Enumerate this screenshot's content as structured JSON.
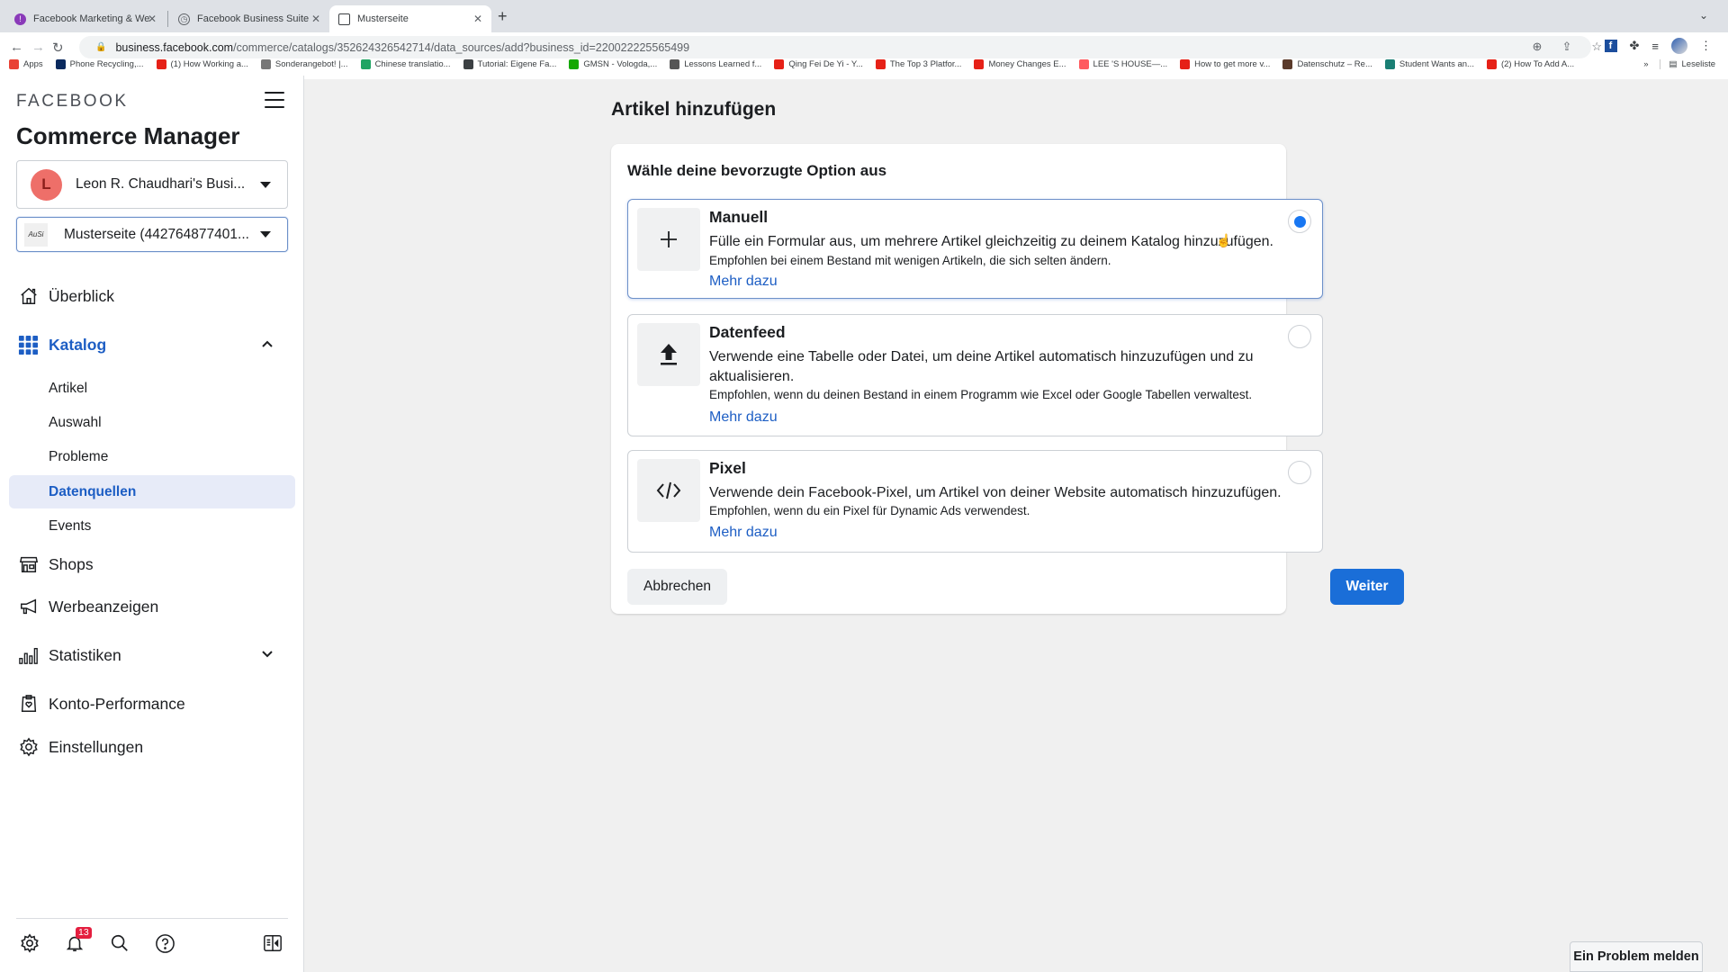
{
  "browser": {
    "tabs": [
      {
        "title": "Facebook Marketing & Werbea",
        "icon": "purple-circle-icon",
        "color": "#8a3ab9"
      },
      {
        "title": "Facebook Business Suite",
        "icon": "business-suite-icon",
        "color": "#5f6368"
      },
      {
        "title": "Musterseite",
        "icon": "page-icon",
        "color": "#3c4043",
        "active": true
      }
    ],
    "url_host": "business.facebook.com",
    "url_path": "/commerce/catalogs/352624326542714/data_sources/add?business_id=220022225565499",
    "bookmarks": [
      {
        "label": "Apps",
        "icon": "apps-grid-icon",
        "color": "#e94235"
      },
      {
        "label": "Phone Recycling,...",
        "icon": "o2-icon",
        "color": "#0a2a5e"
      },
      {
        "label": "(1) How Working a...",
        "icon": "youtube-icon",
        "color": "#e62117"
      },
      {
        "label": "Sonderangebot! |...",
        "icon": "check-badge-icon",
        "color": "#777777"
      },
      {
        "label": "Chinese translatio...",
        "icon": "green-f-icon",
        "color": "#1fa463"
      },
      {
        "label": "Tutorial: Eigene Fa...",
        "icon": "hash-icon",
        "color": "#3c4043"
      },
      {
        "label": "GMSN - Vologda,...",
        "icon": "upwork-icon",
        "color": "#14a800"
      },
      {
        "label": "Lessons Learned f...",
        "icon": "percent-icon",
        "color": "#555555"
      },
      {
        "label": "Qing Fei De Yi - Y...",
        "icon": "youtube-icon",
        "color": "#e62117"
      },
      {
        "label": "The Top 3 Platfor...",
        "icon": "youtube-icon",
        "color": "#e62117"
      },
      {
        "label": "Money Changes E...",
        "icon": "youtube-icon",
        "color": "#e62117"
      },
      {
        "label": "LEE 'S HOUSE—...",
        "icon": "airbnb-icon",
        "color": "#ff5a5f"
      },
      {
        "label": "How to get more v...",
        "icon": "youtube-icon",
        "color": "#e62117"
      },
      {
        "label": "Datenschutz – Re...",
        "icon": "image-thumb-icon",
        "color": "#5a3a2a"
      },
      {
        "label": "Student Wants an...",
        "icon": "teal-t-icon",
        "color": "#1a7f74"
      },
      {
        "label": "(2) How To Add A...",
        "icon": "youtube-icon",
        "color": "#e62117"
      }
    ],
    "reading_list": "Leseliste"
  },
  "sidebar": {
    "brand": "FACEBOOK",
    "app_title": "Commerce Manager",
    "business": {
      "initial": "L",
      "name": "Leon R. Chaudhari's Busi..."
    },
    "page": {
      "logo": "AuSi",
      "name": "Musterseite (442764877401..."
    },
    "nav": {
      "overview": "Überblick",
      "catalog": "Katalog",
      "catalog_sub": [
        "Artikel",
        "Auswahl",
        "Probleme",
        "Datenquellen",
        "Events"
      ],
      "active_sub": "Datenquellen",
      "shops": "Shops",
      "ads": "Werbeanzeigen",
      "stats": "Statistiken",
      "performance": "Konto-Performance",
      "settings": "Einstellungen"
    },
    "notifications_count": "13"
  },
  "main": {
    "page_title": "Artikel hinzufügen",
    "card_title": "Wähle deine bevorzugte Option aus",
    "options": [
      {
        "title": "Manuell",
        "description": "Fülle ein Formular aus, um mehrere Artikel gleichzeitig zu deinem Katalog hinzuzufügen.",
        "recommendation": "Empfohlen bei einem Bestand mit wenigen Artikeln, die sich selten ändern.",
        "link": "Mehr dazu",
        "selected": true
      },
      {
        "title": "Datenfeed",
        "description": "Verwende eine Tabelle oder Datei, um deine Artikel automatisch hinzuzufügen und zu aktualisieren.",
        "recommendation": "Empfohlen, wenn du deinen Bestand in einem Programm wie Excel oder Google Tabellen verwaltest.",
        "link": "Mehr dazu",
        "selected": false
      },
      {
        "title": "Pixel",
        "description": "Verwende dein Facebook-Pixel, um Artikel von deiner Website automatisch hinzuzufügen.",
        "recommendation": "Empfohlen, wenn du ein Pixel für Dynamic Ads verwendest.",
        "link": "Mehr dazu",
        "selected": false
      }
    ],
    "cancel_label": "Abbrechen",
    "next_label": "Weiter",
    "report_label": "Ein Problem melden"
  },
  "colors": {
    "accent": "#1877f2",
    "link": "#1d5ec4",
    "primary_button": "#1a6ed8",
    "badge": "#e41e3f"
  }
}
